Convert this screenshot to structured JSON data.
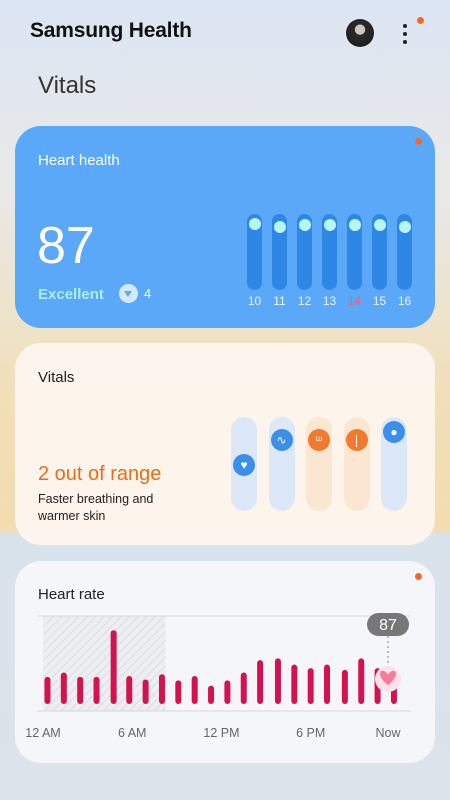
{
  "app": {
    "title": "Samsung Health",
    "icons": {
      "avatar": "user-avatar",
      "more": "more-vertical-icon"
    }
  },
  "page": {
    "title": "Vitals"
  },
  "heart_health": {
    "title": "Heart health",
    "score": "87",
    "status": "Excellent",
    "change": "4",
    "change_icon": "down-arrow-icon",
    "days": [
      "10",
      "11",
      "12",
      "13",
      "14",
      "15",
      "16"
    ],
    "today": "14",
    "levels": [
      0.97,
      0.92,
      0.95,
      0.95,
      0.95,
      0.95,
      0.92
    ],
    "colors": {
      "card": "#5aa8f7",
      "bar": "#2e86e5",
      "knob": "#b9f6f2",
      "today": "#ff5a6a"
    }
  },
  "vitals": {
    "title": "Vitals",
    "headline": "2 out of range",
    "description": "Faster breathing and warmer skin",
    "metrics": [
      {
        "icon": "heart-icon",
        "glyph": "♥",
        "status": "normal",
        "level": 0.49
      },
      {
        "icon": "pulse-icon",
        "glyph": "∿",
        "status": "normal",
        "level": 0.86
      },
      {
        "icon": "lungs-icon",
        "glyph": "ᵚ",
        "status": "out-of-range",
        "level": 0.86
      },
      {
        "icon": "thermometer-icon",
        "glyph": "❘",
        "status": "out-of-range",
        "level": 0.86
      },
      {
        "icon": "oxygen-drop-icon",
        "glyph": "●",
        "status": "normal",
        "level": 0.97
      }
    ],
    "colors": {
      "alert": "#ee6c12",
      "normal": "#3b8fe8"
    }
  },
  "heart_rate": {
    "title": "Heart rate",
    "current_value": "87",
    "x_labels": [
      "12 AM",
      "6 AM",
      "12 PM",
      "6 PM",
      "Now"
    ],
    "chart_data": {
      "type": "bar",
      "title": "Heart rate",
      "x_range_hours": [
        0,
        23.2
      ],
      "highlight_range_hours": [
        0,
        8.25
      ],
      "x_ticks": [
        {
          "label": "12 AM",
          "hour": 0
        },
        {
          "label": "6 AM",
          "hour": 6
        },
        {
          "label": "12 PM",
          "hour": 12
        },
        {
          "label": "6 PM",
          "hour": 18
        },
        {
          "label": "Now",
          "hour": 23.2
        }
      ],
      "series": [
        {
          "values": [
            {
              "hour": 0.3,
              "value": 0.24
            },
            {
              "hour": 1.4,
              "value": 0.29
            },
            {
              "hour": 2.5,
              "value": 0.24
            },
            {
              "hour": 3.6,
              "value": 0.24
            },
            {
              "hour": 4.75,
              "value": 0.77
            },
            {
              "hour": 5.8,
              "value": 0.25
            },
            {
              "hour": 6.9,
              "value": 0.21
            },
            {
              "hour": 8.0,
              "value": 0.27
            },
            {
              "hour": 9.1,
              "value": 0.2
            },
            {
              "hour": 10.2,
              "value": 0.25
            },
            {
              "hour": 11.3,
              "value": 0.14
            },
            {
              "hour": 12.4,
              "value": 0.2
            },
            {
              "hour": 13.5,
              "value": 0.29
            },
            {
              "hour": 14.6,
              "value": 0.43
            },
            {
              "hour": 15.8,
              "value": 0.45
            },
            {
              "hour": 16.9,
              "value": 0.38
            },
            {
              "hour": 18.0,
              "value": 0.34
            },
            {
              "hour": 19.1,
              "value": 0.38
            },
            {
              "hour": 20.3,
              "value": 0.32
            },
            {
              "hour": 21.4,
              "value": 0.45
            },
            {
              "hour": 22.5,
              "value": 0.34
            },
            {
              "hour": 23.6,
              "value": 0.18
            }
          ]
        }
      ],
      "ylim": [
        0,
        1
      ],
      "grid": false
    },
    "colors": {
      "bar": "#d4124f",
      "marker": "#f77b9c",
      "badge": "#777777"
    }
  }
}
